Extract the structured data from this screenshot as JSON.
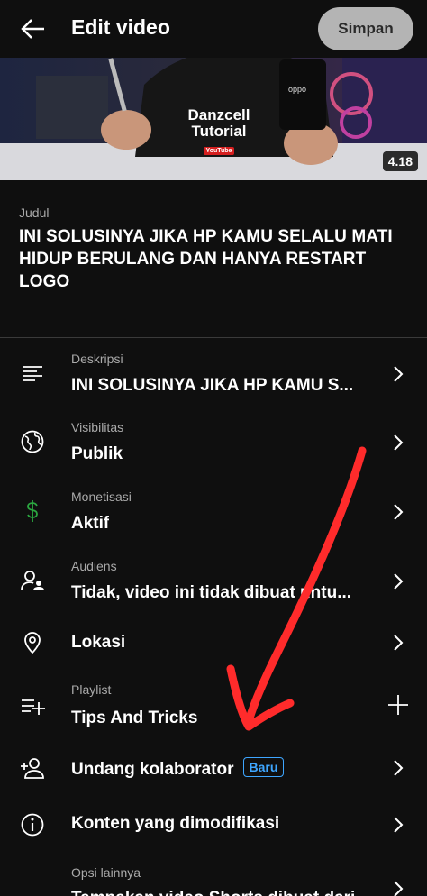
{
  "header": {
    "title": "Edit video",
    "save_label": "Simpan"
  },
  "thumbnail": {
    "duration": "4.18",
    "shirt_line1": "Danzcell",
    "shirt_line2": "Tutorial",
    "shirt_badge": "YouTube",
    "phone_brand": "oppo"
  },
  "title_field": {
    "label": "Judul",
    "value": "INI SOLUSINYA JIKA HP KAMU SELALU MATI HIDUP BERULANG DAN HANYA RESTART LOGO"
  },
  "rows": {
    "description": {
      "label": "Deskripsi",
      "value": "INI SOLUSINYA JIKA HP KAMU S...",
      "icon": "description-icon"
    },
    "visibility": {
      "label": "Visibilitas",
      "value": "Publik",
      "icon": "globe-icon"
    },
    "monetization": {
      "label": "Monetisasi",
      "value": "Aktif",
      "icon": "dollar-icon"
    },
    "audience": {
      "label": "Audiens",
      "value": "Tidak, video ini tidak dibuat untu...",
      "icon": "audience-icon"
    },
    "location": {
      "value": "Lokasi",
      "icon": "location-pin-icon"
    },
    "playlist": {
      "label": "Playlist",
      "value": "Tips And Tricks",
      "icon": "playlist-add-icon"
    },
    "collaborator": {
      "value": "Undang kolaborator",
      "badge": "Baru",
      "icon": "add-person-icon"
    },
    "modified": {
      "value": "Konten yang dimodifikasi",
      "icon": "info-icon"
    },
    "more": {
      "label": "Opsi lainnya",
      "value": "Tampakan video Shorts dibuat dari"
    }
  },
  "colors": {
    "background": "#0f0f0f",
    "accent_blue": "#3ea6ff",
    "monetization_green": "#2ba640",
    "annotation_red": "#ff2b2b"
  }
}
